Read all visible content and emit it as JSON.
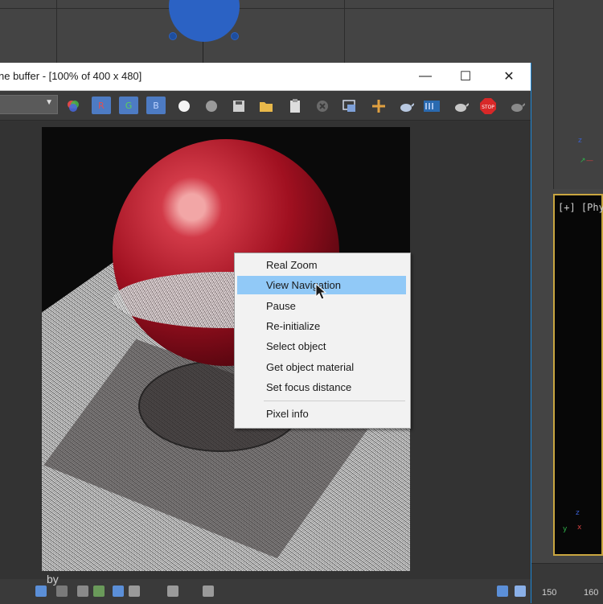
{
  "window": {
    "title": "ne buffer - [100% of 400 x 480]",
    "minimize_glyph": "—",
    "maximize_glyph": "☐",
    "close_glyph": "✕"
  },
  "toolbar": {
    "channel_red": "R",
    "channel_green": "G",
    "channel_blue": "B",
    "stop_label": "STOP",
    "icons": [
      "color-picker-icon",
      "white-dot-icon",
      "gray-dot-icon",
      "save-icon",
      "open-folder-icon",
      "clipboard-icon",
      "clear-icon",
      "region-icon",
      "pan-icon",
      "teapot-icon",
      "film-icon",
      "teapot-render-icon",
      "stop-icon",
      "teapot-gray-icon"
    ]
  },
  "viewport_right": {
    "label": "[+] [Phys",
    "ruler_ticks": [
      "150",
      "160"
    ]
  },
  "context_menu": {
    "items": [
      {
        "label": "Real Zoom",
        "highlighted": false
      },
      {
        "label": "View Navigation",
        "highlighted": true
      },
      {
        "label": "Pause",
        "highlighted": false
      },
      {
        "label": "Re-initialize",
        "highlighted": false
      },
      {
        "label": "Select object",
        "highlighted": false
      },
      {
        "label": "Get object material",
        "highlighted": false
      },
      {
        "label": "Set focus distance",
        "highlighted": false
      }
    ],
    "footer_item": "Pixel info"
  },
  "watermark": {
    "by": "by"
  },
  "colors": {
    "highlight": "#91c9f7",
    "channel_button": "#4d7bc3",
    "viewport_border": "#c9a640",
    "window_border": "#1c87d6"
  }
}
